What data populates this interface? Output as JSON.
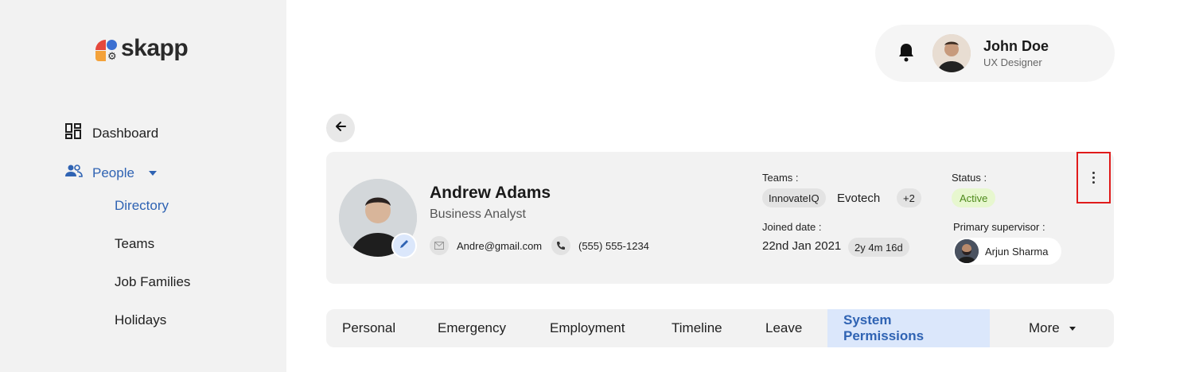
{
  "app": {
    "logo_text": "skapp"
  },
  "sidebar": {
    "items": [
      {
        "label": "Dashboard",
        "icon": "dashboard-icon"
      },
      {
        "label": "People",
        "icon": "people-icon"
      }
    ],
    "people_sub": [
      "Directory",
      "Teams",
      "Job Families",
      "Holidays"
    ]
  },
  "header": {
    "user_name": "John Doe",
    "user_role": "UX Designer",
    "icons": [
      "bell-icon",
      "avatar"
    ]
  },
  "profile": {
    "name": "Andrew Adams",
    "title": "Business Analyst",
    "email": "Andre@gmail.com",
    "phone": "(555) 555-1234",
    "teams_label": "Teams :",
    "teams": [
      "InnovateIQ",
      "Evotech"
    ],
    "teams_more": "+2",
    "status_label": "Status :",
    "status": "Active",
    "joined_label": "Joined date :",
    "joined_date": "22nd Jan 2021",
    "tenure": "2y 4m 16d",
    "supervisor_label": "Primary supervisor :",
    "supervisor_name": "Arjun Sharma"
  },
  "tabs": [
    "Personal",
    "Emergency",
    "Employment",
    "Timeline",
    "Leave",
    "System Permissions",
    "More"
  ],
  "colors": {
    "accent": "#2f63b3",
    "active_tab_bg": "#dbe7fb",
    "status_bg": "#e7f7cf",
    "highlight": "#e01b1b"
  }
}
